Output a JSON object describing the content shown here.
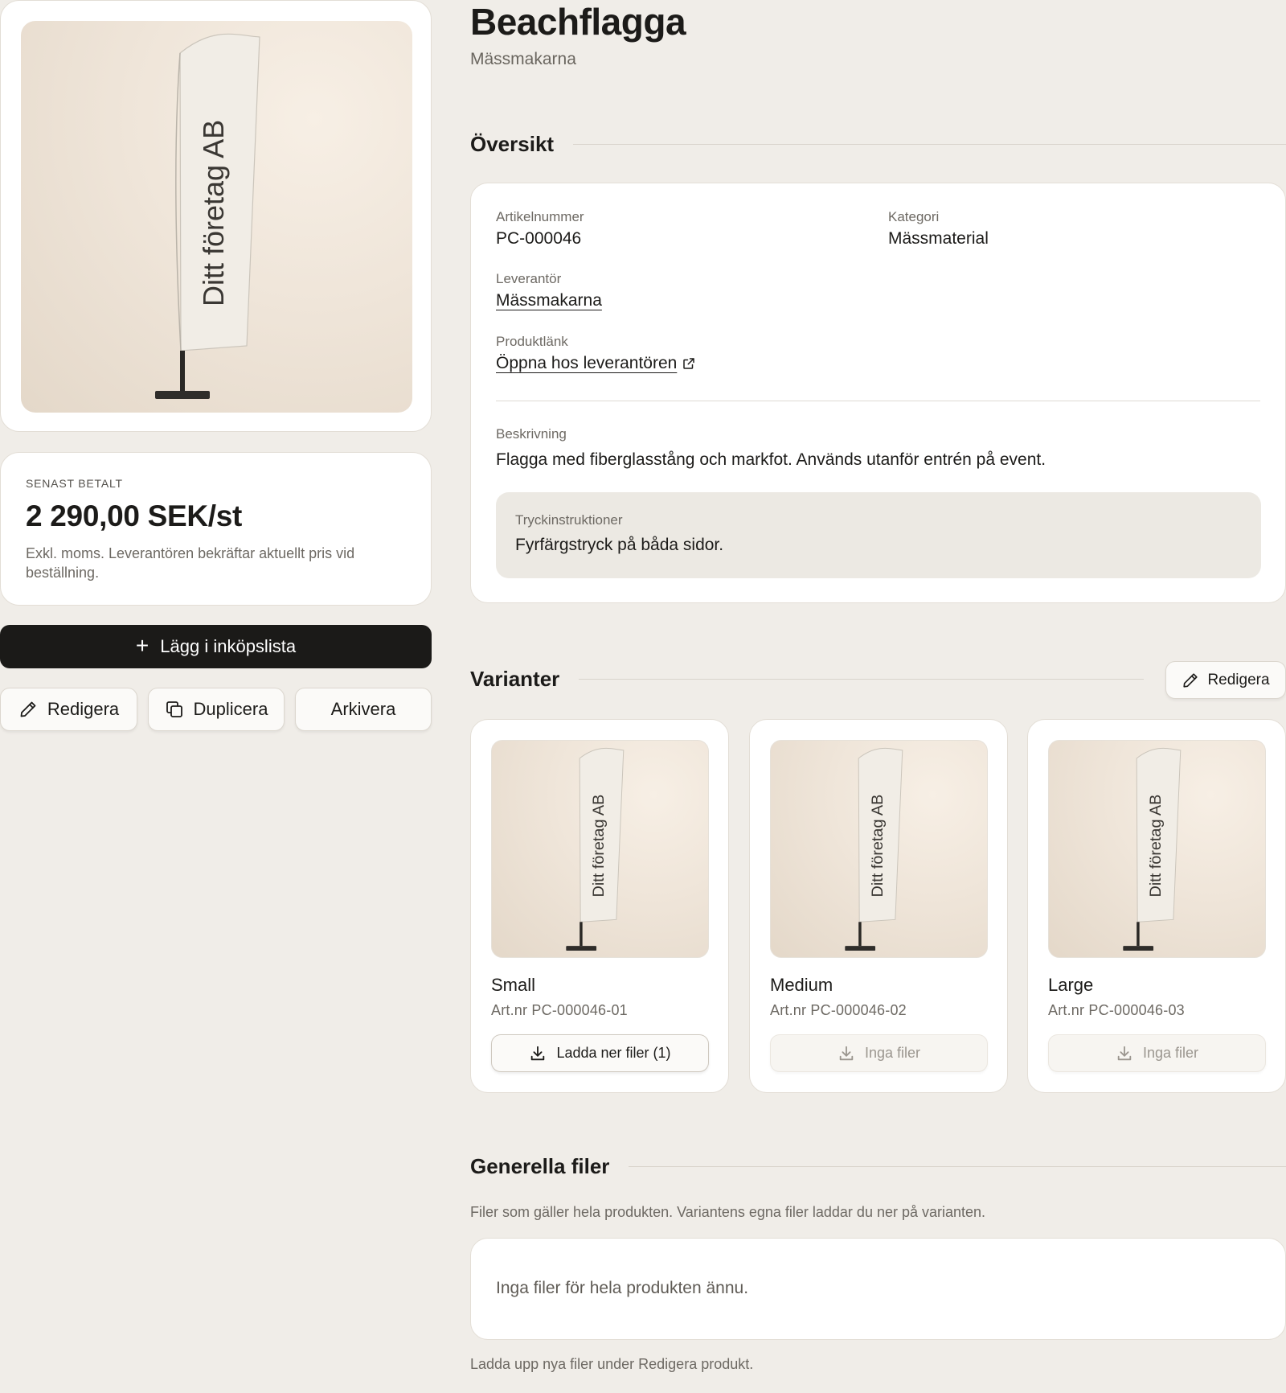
{
  "product": {
    "title": "Beachflagga",
    "supplier_name": "Mässmakarna",
    "image_flag_text": "Ditt företag AB"
  },
  "price": {
    "eyebrow": "SENAST BETALT",
    "value": "2 290,00 SEK/st",
    "note": "Exkl. moms. Leverantören bekräftar aktuellt pris vid beställning."
  },
  "actions": {
    "add_to_list": "Lägg i inköpslista",
    "edit": "Redigera",
    "duplicate": "Duplicera",
    "archive": "Arkivera"
  },
  "overview": {
    "heading": "Översikt",
    "article_label": "Artikelnummer",
    "article_value": "PC-000046",
    "category_label": "Kategori",
    "category_value": "Mässmaterial",
    "supplier_label": "Leverantör",
    "supplier_value": "Mässmakarna",
    "link_label": "Produktlänk",
    "link_value": "Öppna hos leverantören",
    "description_label": "Beskrivning",
    "description_value": "Flagga med fiberglasstång och markfot. Används utanför entrén på event.",
    "print_label": "Tryckinstruktioner",
    "print_value": "Fyrfärgstryck på båda sidor."
  },
  "variants": {
    "heading": "Varianter",
    "edit_label": "Redigera",
    "items": [
      {
        "name": "Small",
        "art": "Art.nr PC-000046-01",
        "button": "Ladda ner filer (1)",
        "has_files": true
      },
      {
        "name": "Medium",
        "art": "Art.nr PC-000046-02",
        "button": "Inga filer",
        "has_files": false
      },
      {
        "name": "Large",
        "art": "Art.nr PC-000046-03",
        "button": "Inga filer",
        "has_files": false
      }
    ]
  },
  "general_files": {
    "heading": "Generella filer",
    "description": "Filer som gäller hela produkten. Variantens egna filer laddar du ner på varianten.",
    "empty": "Inga filer för hela produkten ännu.",
    "hint": "Ladda upp nya filer under Redigera produkt."
  },
  "icons": [
    "plus-icon",
    "pencil-icon",
    "copy-icon",
    "external-link-icon",
    "download-icon"
  ]
}
